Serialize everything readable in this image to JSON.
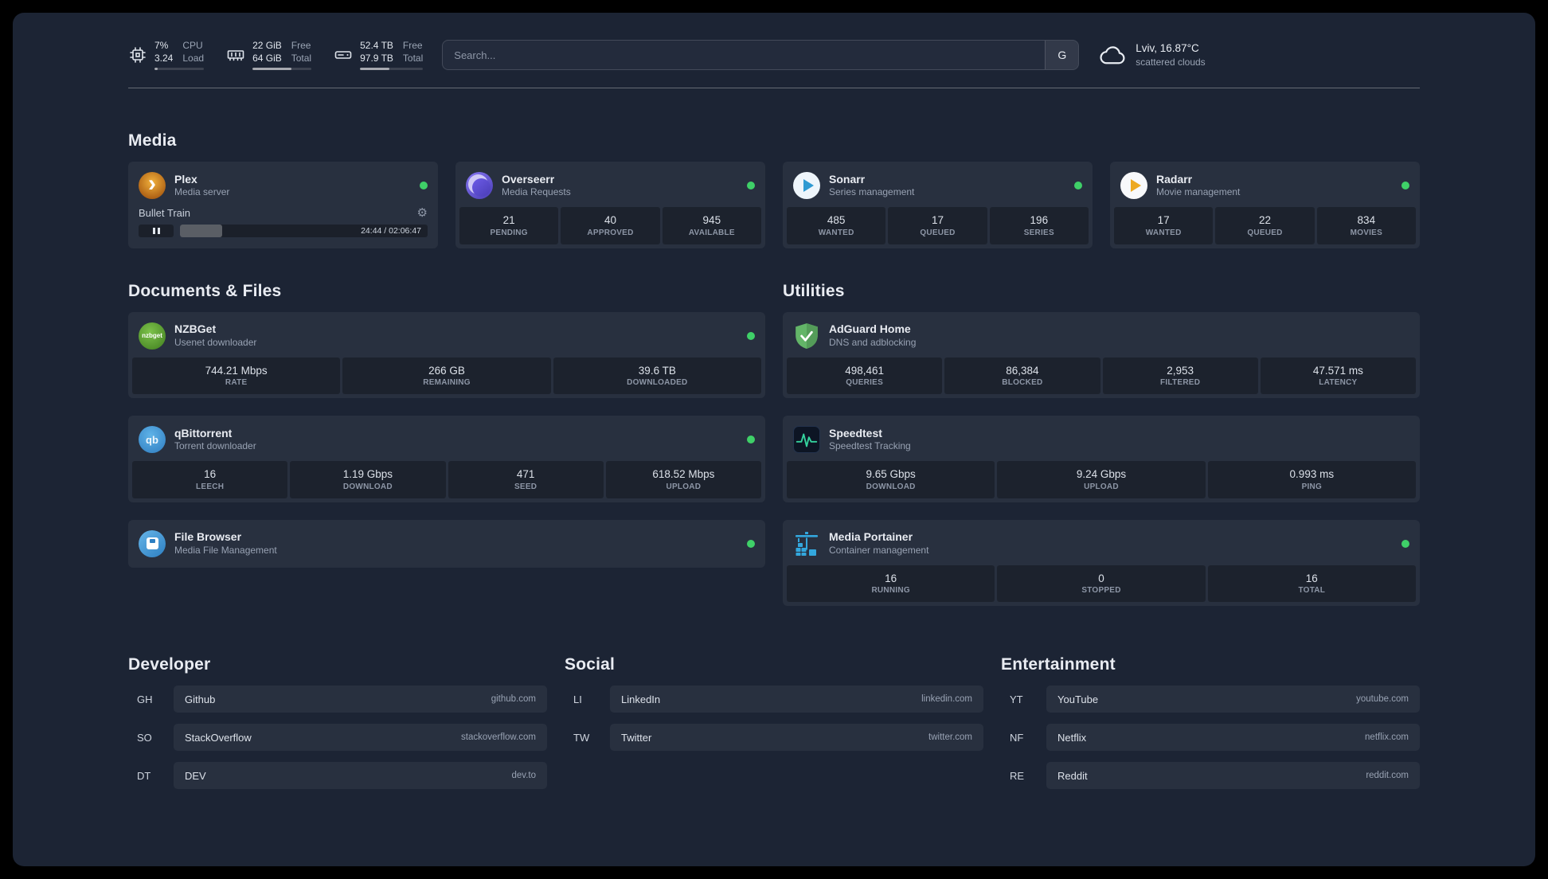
{
  "theme": {
    "background": "#1c2434",
    "card_background": "#262e3e",
    "status_online_color": "#3fd068",
    "text_primary": "#e9ecf2",
    "text_secondary": "#98a2b3"
  },
  "topbar": {
    "resources": [
      {
        "icon": "cpu-icon",
        "values": [
          "7%",
          "3.24"
        ],
        "labels": [
          "CPU",
          "Load"
        ],
        "percent": 7
      },
      {
        "icon": "memory-icon",
        "values": [
          "22 GiB",
          "64 GiB"
        ],
        "labels": [
          "Free",
          "Total"
        ],
        "percent": 66
      },
      {
        "icon": "disk-icon",
        "values": [
          "52.4 TB",
          "97.9 TB"
        ],
        "labels": [
          "Free",
          "Total"
        ],
        "percent": 46
      }
    ],
    "search": {
      "placeholder": "Search...",
      "provider_label": "G"
    },
    "weather": {
      "location": "Lviv, 16.87°C",
      "condition": "scattered clouds"
    }
  },
  "sections": {
    "media": {
      "title": "Media",
      "services": [
        {
          "name": "Plex",
          "desc": "Media server",
          "status": "online",
          "player": {
            "track": "Bullet Train",
            "time": "24:44 / 02:06:47",
            "progress_percent": 17
          }
        },
        {
          "name": "Overseerr",
          "desc": "Media Requests",
          "status": "online",
          "stats": [
            {
              "value": "21",
              "label": "PENDING"
            },
            {
              "value": "40",
              "label": "APPROVED"
            },
            {
              "value": "945",
              "label": "AVAILABLE"
            }
          ]
        },
        {
          "name": "Sonarr",
          "desc": "Series management",
          "status": "online",
          "stats": [
            {
              "value": "485",
              "label": "WANTED"
            },
            {
              "value": "17",
              "label": "QUEUED"
            },
            {
              "value": "196",
              "label": "SERIES"
            }
          ]
        },
        {
          "name": "Radarr",
          "desc": "Movie management",
          "status": "online",
          "stats": [
            {
              "value": "17",
              "label": "WANTED"
            },
            {
              "value": "22",
              "label": "QUEUED"
            },
            {
              "value": "834",
              "label": "MOVIES"
            }
          ]
        }
      ]
    },
    "documents": {
      "title": "Documents & Files",
      "services": [
        {
          "name": "NZBGet",
          "desc": "Usenet downloader",
          "status": "online",
          "stats": [
            {
              "value": "744.21 Mbps",
              "label": "RATE"
            },
            {
              "value": "266 GB",
              "label": "REMAINING"
            },
            {
              "value": "39.6 TB",
              "label": "DOWNLOADED"
            }
          ]
        },
        {
          "name": "qBittorrent",
          "desc": "Torrent downloader",
          "status": "online",
          "stats": [
            {
              "value": "16",
              "label": "LEECH"
            },
            {
              "value": "1.19 Gbps",
              "label": "DOWNLOAD"
            },
            {
              "value": "471",
              "label": "SEED"
            },
            {
              "value": "618.52 Mbps",
              "label": "UPLOAD"
            }
          ]
        },
        {
          "name": "File Browser",
          "desc": "Media File Management",
          "status": "online",
          "stats": []
        }
      ]
    },
    "utilities": {
      "title": "Utilities",
      "services": [
        {
          "name": "AdGuard Home",
          "desc": "DNS and adblocking",
          "status": "none",
          "stats": [
            {
              "value": "498,461",
              "label": "QUERIES"
            },
            {
              "value": "86,384",
              "label": "BLOCKED"
            },
            {
              "value": "2,953",
              "label": "FILTERED"
            },
            {
              "value": "47.571 ms",
              "label": "LATENCY"
            }
          ]
        },
        {
          "name": "Speedtest",
          "desc": "Speedtest Tracking",
          "status": "none",
          "stats": [
            {
              "value": "9.65 Gbps",
              "label": "DOWNLOAD"
            },
            {
              "value": "9.24 Gbps",
              "label": "UPLOAD"
            },
            {
              "value": "0.993 ms",
              "label": "PING"
            }
          ]
        },
        {
          "name": "Media Portainer",
          "desc": "Container management",
          "status": "online",
          "stats": [
            {
              "value": "16",
              "label": "RUNNING"
            },
            {
              "value": "0",
              "label": "STOPPED"
            },
            {
              "value": "16",
              "label": "TOTAL"
            }
          ]
        }
      ]
    }
  },
  "bookmarks": [
    {
      "title": "Developer",
      "items": [
        {
          "abbr": "GH",
          "name": "Github",
          "url": "github.com"
        },
        {
          "abbr": "SO",
          "name": "StackOverflow",
          "url": "stackoverflow.com"
        },
        {
          "abbr": "DT",
          "name": "DEV",
          "url": "dev.to"
        }
      ]
    },
    {
      "title": "Social",
      "items": [
        {
          "abbr": "LI",
          "name": "LinkedIn",
          "url": "linkedin.com"
        },
        {
          "abbr": "TW",
          "name": "Twitter",
          "url": "twitter.com"
        }
      ]
    },
    {
      "title": "Entertainment",
      "items": [
        {
          "abbr": "YT",
          "name": "YouTube",
          "url": "youtube.com"
        },
        {
          "abbr": "NF",
          "name": "Netflix",
          "url": "netflix.com"
        },
        {
          "abbr": "RE",
          "name": "Reddit",
          "url": "reddit.com"
        }
      ]
    }
  ]
}
